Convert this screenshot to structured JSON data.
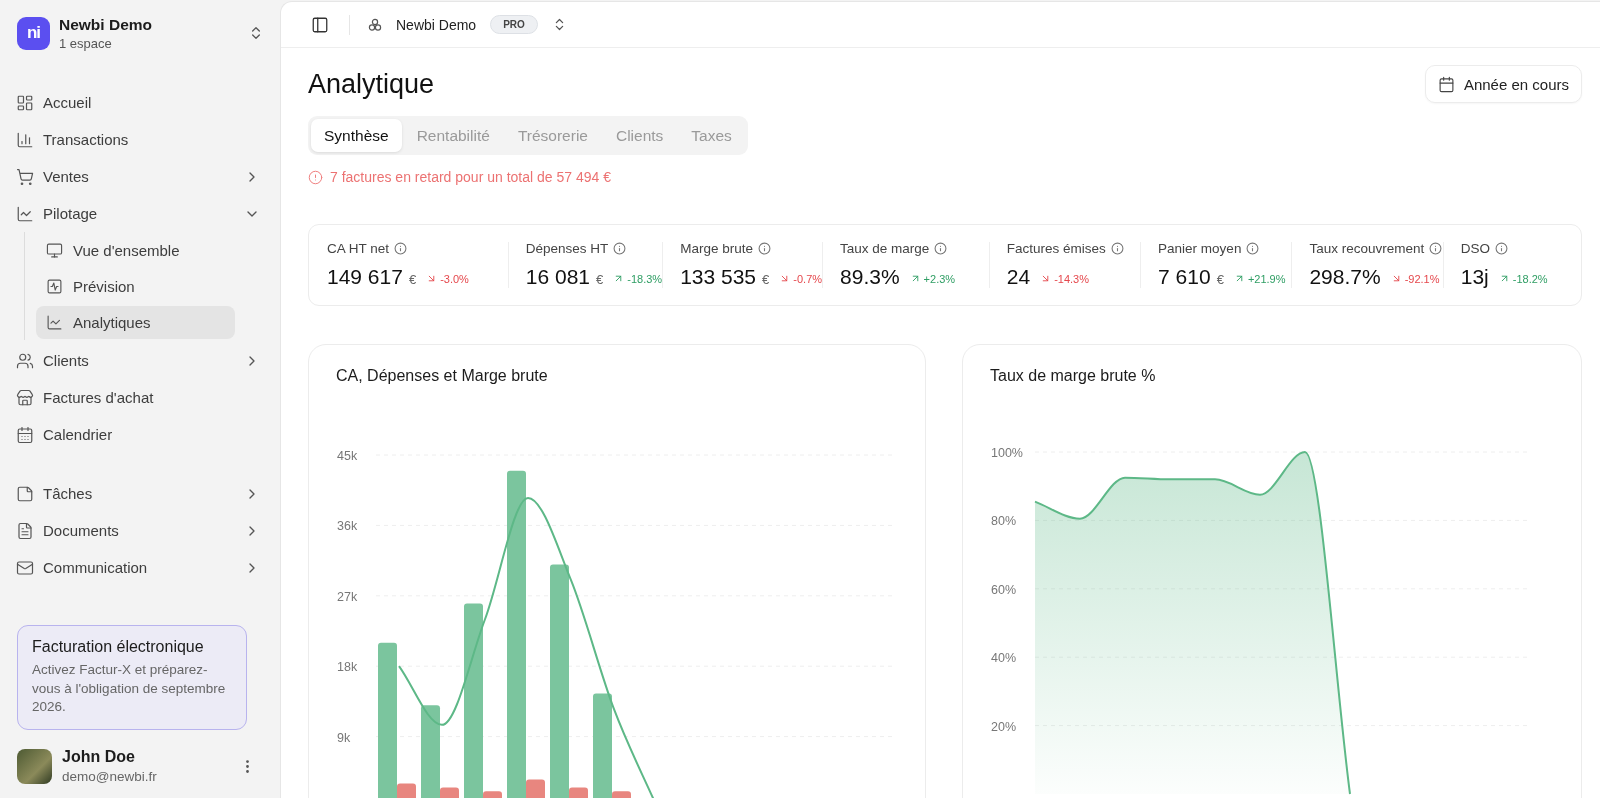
{
  "workspace": {
    "logo_text": "ni",
    "name": "Newbi Demo",
    "subtitle": "1 espace"
  },
  "sidebar": {
    "sections": [
      {
        "items": [
          {
            "label": "Accueil",
            "selected": false
          },
          {
            "label": "Transactions",
            "selected": false
          },
          {
            "label": "Ventes",
            "selected": false,
            "expanded": false
          },
          {
            "label": "Pilotage",
            "selected": false,
            "expanded": true,
            "children": [
              {
                "label": "Vue d'ensemble",
                "selected": false
              },
              {
                "label": "Prévision",
                "selected": false
              },
              {
                "label": "Analytiques",
                "selected": true
              }
            ]
          },
          {
            "label": "Clients",
            "selected": false,
            "expanded": false
          },
          {
            "label": "Factures d'achat",
            "selected": false
          },
          {
            "label": "Calendrier",
            "selected": false
          }
        ]
      },
      {
        "items": [
          {
            "label": "Tâches",
            "selected": false,
            "expanded": false
          },
          {
            "label": "Documents",
            "selected": false,
            "expanded": false
          },
          {
            "label": "Communication",
            "selected": false,
            "expanded": false
          }
        ]
      }
    ],
    "promo": {
      "title": "Facturation électronique",
      "text": "Activez Factur-X et préparez-vous à l'obligation de septembre 2026."
    },
    "user": {
      "name": "John Doe",
      "email": "demo@newbi.fr"
    }
  },
  "topbar": {
    "workspace": "Newbi Demo",
    "plan": "PRO"
  },
  "page": {
    "title": "Analytique",
    "period_button": "Année en cours",
    "tabs": [
      {
        "label": "Synthèse",
        "selected": true
      },
      {
        "label": "Rentabilité",
        "selected": false
      },
      {
        "label": "Trésorerie",
        "selected": false
      },
      {
        "label": "Clients",
        "selected": false
      },
      {
        "label": "Taxes",
        "selected": false
      }
    ],
    "alert": "7 factures en retard pour un total de 57 494 €",
    "kpis": [
      {
        "label": "CA HT net",
        "value": "149 617",
        "unit": "€",
        "change": "-3.0%",
        "up": false
      },
      {
        "label": "Dépenses HT",
        "value": "16 081",
        "unit": "€",
        "change": "-18.3%",
        "up": true
      },
      {
        "label": "Marge brute",
        "value": "133 535",
        "unit": "€",
        "change": "-0.7%",
        "up": false
      },
      {
        "label": "Taux de marge",
        "value": "89.3%",
        "change": "+2.3%",
        "up": true
      },
      {
        "label": "Factures émises",
        "value": "24",
        "change": "-14.3%",
        "up": false
      },
      {
        "label": "Panier moyen",
        "value": "7 610",
        "unit": "€",
        "change": "+21.9%",
        "up": true
      },
      {
        "label": "Taux recouvrement",
        "value": "298.7%",
        "change": "-92.1%",
        "up": false
      },
      {
        "label": "DSO",
        "value": "13j",
        "change": "-18.2%",
        "up": true
      }
    ],
    "charts": [
      {
        "chart_data": {
          "type": "bar",
          "title": "CA, Dépenses et Marge brute",
          "ylim": [
            0,
            45000
          ],
          "stacked": false,
          "grid": true,
          "yticks": [
            {
              "value": 9000,
              "label": "9k"
            },
            {
              "value": 18000,
              "label": "18k"
            },
            {
              "value": 27000,
              "label": "27k"
            },
            {
              "value": 36000,
              "label": "36k"
            },
            {
              "value": 45000,
              "label": "45k"
            }
          ],
          "series": [
            {
              "type": "bar",
              "color": "#7bc59e",
              "values": [
                21000,
                13000,
                26000,
                43000,
                31000,
                14500,
                0,
                0,
                0,
                0,
                0,
                0
              ]
            },
            {
              "type": "bar",
              "color": "#e8867f",
              "values": [
                3000,
                2500,
                2000,
                3500,
                2500,
                2000,
                0,
                0,
                0,
                0,
                0,
                0
              ]
            },
            {
              "type": "line",
              "color": "#5db887",
              "values": [
                18000,
                10500,
                24000,
                39500,
                29000,
                12500,
                0,
                null,
                null,
                null,
                null,
                null
              ]
            }
          ]
        }
      },
      {
        "chart_data": {
          "type": "area",
          "title": "Taux de marge brute %",
          "ylim": [
            0,
            100
          ],
          "grid": true,
          "yticks": [
            {
              "value": 20,
              "label": "20%"
            },
            {
              "value": 40,
              "label": "40%"
            },
            {
              "value": 60,
              "label": "60%"
            },
            {
              "value": 80,
              "label": "80%"
            },
            {
              "value": 100,
              "label": "100%"
            }
          ],
          "series": [
            {
              "color": "#5db887",
              "values": [
                85.5,
                80.5,
                92.5,
                92,
                92,
                87.5,
                100,
                0,
                null,
                null,
                null,
                null
              ]
            }
          ]
        }
      }
    ]
  }
}
